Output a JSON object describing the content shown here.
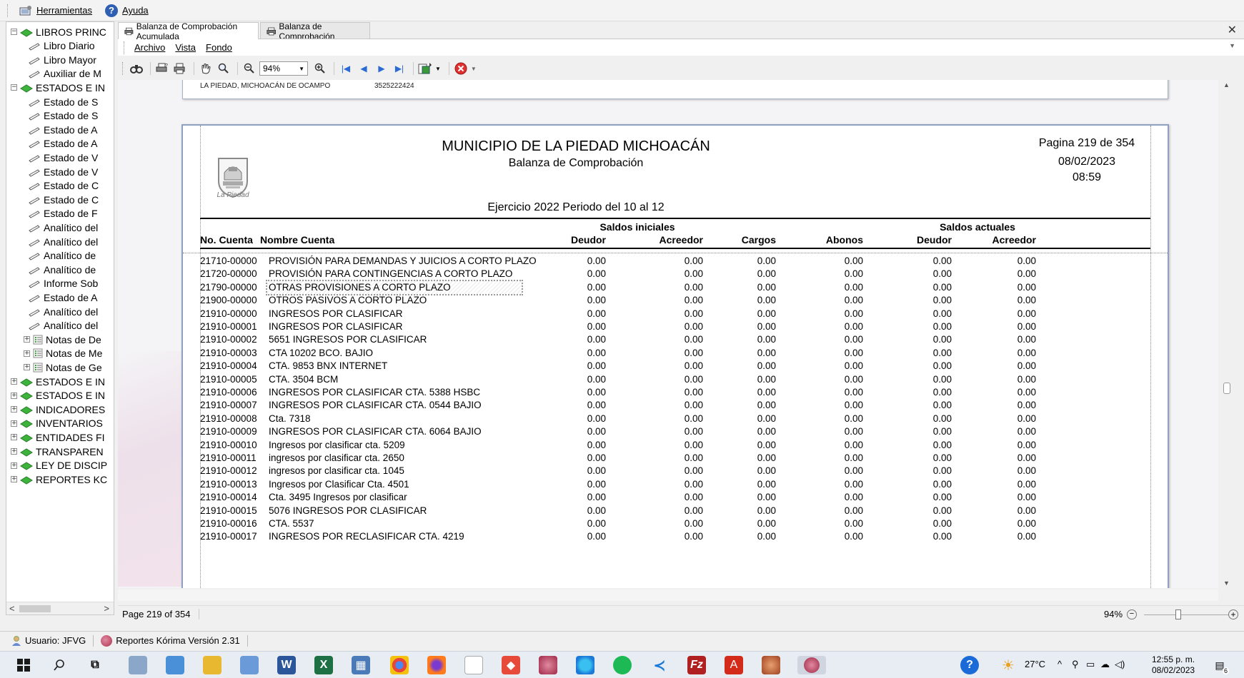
{
  "topmenu": {
    "tools": "Herramientas",
    "help": "Ayuda"
  },
  "tree": {
    "nodes": [
      {
        "label": "LIBROS PRINC",
        "type": "group",
        "exp": "−"
      },
      {
        "label": "Libro Diario",
        "type": "leaf"
      },
      {
        "label": "Libro Mayor",
        "type": "leaf"
      },
      {
        "label": "Auxiliar de M",
        "type": "leaf"
      },
      {
        "label": "ESTADOS E IN",
        "type": "group",
        "exp": "−"
      },
      {
        "label": "Estado de S",
        "type": "leaf"
      },
      {
        "label": "Estado de S",
        "type": "leaf"
      },
      {
        "label": "Estado de A",
        "type": "leaf"
      },
      {
        "label": "Estado de A",
        "type": "leaf"
      },
      {
        "label": "Estado de V",
        "type": "leaf"
      },
      {
        "label": "Estado de V",
        "type": "leaf"
      },
      {
        "label": "Estado de C",
        "type": "leaf"
      },
      {
        "label": "Estado de C",
        "type": "leaf"
      },
      {
        "label": "Estado de F",
        "type": "leaf"
      },
      {
        "label": "Analítico del",
        "type": "leaf"
      },
      {
        "label": "Analítico del",
        "type": "leaf"
      },
      {
        "label": "Analítico de",
        "type": "leaf"
      },
      {
        "label": "Analítico de",
        "type": "leaf"
      },
      {
        "label": "Informe Sob",
        "type": "leaf"
      },
      {
        "label": "Estado de A",
        "type": "leaf"
      },
      {
        "label": "Analítico del",
        "type": "leaf"
      },
      {
        "label": "Analítico del",
        "type": "leaf"
      },
      {
        "label": "Notas de De",
        "type": "notes",
        "exp": "+"
      },
      {
        "label": "Notas de Me",
        "type": "notes",
        "exp": "+"
      },
      {
        "label": "Notas de Ge",
        "type": "notes",
        "exp": "+"
      },
      {
        "label": "ESTADOS E IN",
        "type": "group",
        "exp": "+"
      },
      {
        "label": "ESTADOS E IN",
        "type": "group",
        "exp": "+"
      },
      {
        "label": "INDICADORES",
        "type": "group",
        "exp": "+"
      },
      {
        "label": "INVENTARIOS",
        "type": "group",
        "exp": "+"
      },
      {
        "label": "ENTIDADES FI",
        "type": "group",
        "exp": "+"
      },
      {
        "label": "TRANSPAREN",
        "type": "group",
        "exp": "+"
      },
      {
        "label": "LEY DE DISCIP",
        "type": "group",
        "exp": "+"
      },
      {
        "label": "REPORTES KC",
        "type": "group",
        "exp": "+"
      }
    ]
  },
  "tabs": [
    {
      "label": "Balanza de Comprobación Acumulada"
    },
    {
      "label": "Balanza de Comprobación"
    }
  ],
  "docmenu": {
    "file": "Archivo",
    "view": "Vista",
    "background": "Fondo"
  },
  "toolbar": {
    "zoom": "94%"
  },
  "prev_page": {
    "address": "LA PIEDAD, MICHOACÁN DE OCAMPO",
    "phone": "3525222424"
  },
  "report": {
    "title": "MUNICIPIO DE LA PIEDAD MICHOACÁN",
    "subtitle": "Balanza de Comprobación",
    "period": "Ejercicio 2022 Periodo del 10 al 12",
    "page_label": "Pagina 219 de 354",
    "date": "08/02/2023",
    "time": "08:59",
    "logo_text": "La Piedad",
    "headers": {
      "saldos_iniciales": "Saldos iniciales",
      "saldos_actuales": "Saldos actuales",
      "no_cuenta": "No. Cuenta",
      "nombre_cuenta": "Nombre Cuenta",
      "deudor": "Deudor",
      "acreedor": "Acreedor",
      "cargos": "Cargos",
      "abonos": "Abonos",
      "deudor2": "Deudor",
      "acreedor2": "Acreedor"
    },
    "rows": [
      [
        "21710-00000",
        "PROVISIÓN PARA DEMANDAS Y JUICIOS A CORTO PLAZO",
        "0.00",
        "0.00",
        "0.00",
        "0.00",
        "0.00",
        "0.00"
      ],
      [
        "21720-00000",
        "PROVISIÓN PARA CONTINGENCIAS A CORTO PLAZO",
        "0.00",
        "0.00",
        "0.00",
        "0.00",
        "0.00",
        "0.00"
      ],
      [
        "21790-00000",
        "OTRAS PROVISIONES A CORTO PLAZO",
        "0.00",
        "0.00",
        "0.00",
        "0.00",
        "0.00",
        "0.00"
      ],
      [
        "21900-00000",
        "OTROS PASIVOS A CORTO PLAZO",
        "0.00",
        "0.00",
        "0.00",
        "0.00",
        "0.00",
        "0.00"
      ],
      [
        "21910-00000",
        "INGRESOS POR CLASIFICAR",
        "0.00",
        "0.00",
        "0.00",
        "0.00",
        "0.00",
        "0.00"
      ],
      [
        "21910-00001",
        "INGRESOS POR CLASIFICAR",
        "0.00",
        "0.00",
        "0.00",
        "0.00",
        "0.00",
        "0.00"
      ],
      [
        "21910-00002",
        "5651 INGRESOS POR CLASIFICAR",
        "0.00",
        "0.00",
        "0.00",
        "0.00",
        "0.00",
        "0.00"
      ],
      [
        "21910-00003",
        "CTA 10202 BCO. BAJIO",
        "0.00",
        "0.00",
        "0.00",
        "0.00",
        "0.00",
        "0.00"
      ],
      [
        "21910-00004",
        "CTA. 9853 BNX INTERNET",
        "0.00",
        "0.00",
        "0.00",
        "0.00",
        "0.00",
        "0.00"
      ],
      [
        "21910-00005",
        "CTA. 3504 BCM",
        "0.00",
        "0.00",
        "0.00",
        "0.00",
        "0.00",
        "0.00"
      ],
      [
        "21910-00006",
        "INGRESOS POR CLASIFICAR CTA. 5388 HSBC",
        "0.00",
        "0.00",
        "0.00",
        "0.00",
        "0.00",
        "0.00"
      ],
      [
        "21910-00007",
        "INGRESOS POR CLASIFICAR CTA. 0544 BAJIO",
        "0.00",
        "0.00",
        "0.00",
        "0.00",
        "0.00",
        "0.00"
      ],
      [
        "21910-00008",
        "Cta. 7318",
        "0.00",
        "0.00",
        "0.00",
        "0.00",
        "0.00",
        "0.00"
      ],
      [
        "21910-00009",
        "INGRESOS POR CLASIFICAR CTA. 6064 BAJIO",
        "0.00",
        "0.00",
        "0.00",
        "0.00",
        "0.00",
        "0.00"
      ],
      [
        "21910-00010",
        "Ingresos por clasificar cta. 5209",
        "0.00",
        "0.00",
        "0.00",
        "0.00",
        "0.00",
        "0.00"
      ],
      [
        "21910-00011",
        "ingresos por clasificar cta. 2650",
        "0.00",
        "0.00",
        "0.00",
        "0.00",
        "0.00",
        "0.00"
      ],
      [
        "21910-00012",
        "ingresos por clasificar cta. 1045",
        "0.00",
        "0.00",
        "0.00",
        "0.00",
        "0.00",
        "0.00"
      ],
      [
        "21910-00013",
        "Ingresos por Clasificar Cta. 4501",
        "0.00",
        "0.00",
        "0.00",
        "0.00",
        "0.00",
        "0.00"
      ],
      [
        "21910-00014",
        "Cta. 3495 Ingresos por clasificar",
        "0.00",
        "0.00",
        "0.00",
        "0.00",
        "0.00",
        "0.00"
      ],
      [
        "21910-00015",
        "5076 INGRESOS POR CLASIFICAR",
        "0.00",
        "0.00",
        "0.00",
        "0.00",
        "0.00",
        "0.00"
      ],
      [
        "21910-00016",
        "CTA. 5537",
        "0.00",
        "0.00",
        "0.00",
        "0.00",
        "0.00",
        "0.00"
      ],
      [
        "21910-00017",
        "INGRESOS POR RECLASIFICAR CTA. 4219",
        "0.00",
        "0.00",
        "0.00",
        "0.00",
        "0.00",
        "0.00"
      ]
    ]
  },
  "statusbar": {
    "page": "Page 219 of 354",
    "zoom": "94%"
  },
  "appstatus": {
    "user": "Usuario: JFVG",
    "version": "Reportes Kórima Versión 2.31"
  },
  "taskbar": {
    "temp": "27°C",
    "time": "12:55 p. m.",
    "date": "08/02/2023",
    "notif": "6"
  },
  "colors": {
    "tree_green": "#3cb43c",
    "accent_blue": "#2a6ad2",
    "page_border": "#8fa0c0"
  }
}
